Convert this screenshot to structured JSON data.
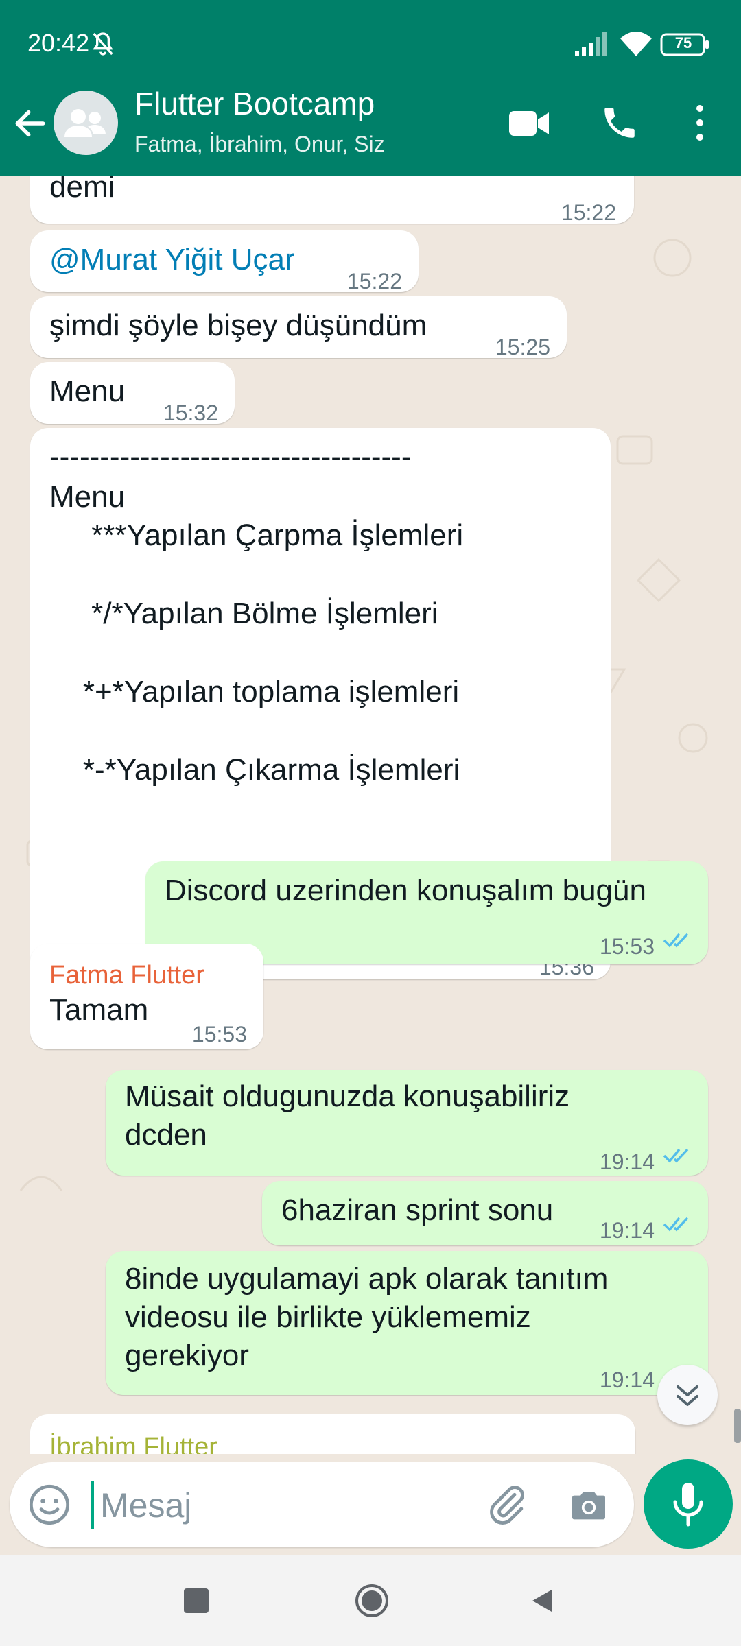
{
  "status_bar": {
    "time": "20:42",
    "battery": "75"
  },
  "header": {
    "title": "Flutter Bootcamp",
    "members": "Fatma, İbrahim, Onur, Siz"
  },
  "messages": [
    {
      "text": "demi",
      "time": "15:22"
    },
    {
      "text": "@Murat Yiğit Uçar",
      "time": "15:22"
    },
    {
      "text": "şimdi şöyle bişey düşündüm",
      "time": "15:25"
    },
    {
      "text": "Menu",
      "time": "15:32"
    },
    {
      "lines": [
        "------------------------------------",
        "Menu",
        "     ***Yapılan Çarpma İşlemleri",
        "",
        "     */*Yapılan Bölme İşlemleri",
        "",
        "    *+*Yapılan toplama işlemleri",
        "",
        "    *-*Yapılan Çıkarma İşlemleri"
      ],
      "time": "15:36"
    },
    {
      "text": "Discord uzerinden konuşalım bugün",
      "time": "15:53"
    },
    {
      "sender": "Fatma Flutter",
      "text": "Tamam",
      "time": "15:53"
    },
    {
      "lines": [
        "Müsait oldugunuzda konuşabiliriz",
        "dcden"
      ],
      "time": "19:14"
    },
    {
      "text": "6haziran sprint sonu",
      "time": "19:14"
    },
    {
      "lines": [
        "8inde uygulamayi apk olarak tanıtım",
        "videosu ile birlikte yüklememiz",
        "gerekiyor"
      ],
      "time": "19:14"
    },
    {
      "sender": "İbrahim Flutter"
    }
  ],
  "composer": {
    "placeholder": "Mesaj"
  },
  "colors": {
    "header": "#008069",
    "chat_background": "#efe7de",
    "outgoing_bubble": "#d9fdd3",
    "incoming_bubble": "#ffffff",
    "accent": "#00a884",
    "read_ticks": "#53bdeb",
    "sender_fatma": "#e8633a",
    "sender_ibrahim": "#a5b337",
    "mention": "#027eb5"
  },
  "icons": [
    "back-arrow-icon",
    "group-avatar-icon",
    "video-call-icon",
    "phone-icon",
    "more-vertical-icon",
    "emoji-icon",
    "attach-icon",
    "camera-icon",
    "mic-icon",
    "double-check-icon",
    "chevron-double-down-icon"
  ]
}
